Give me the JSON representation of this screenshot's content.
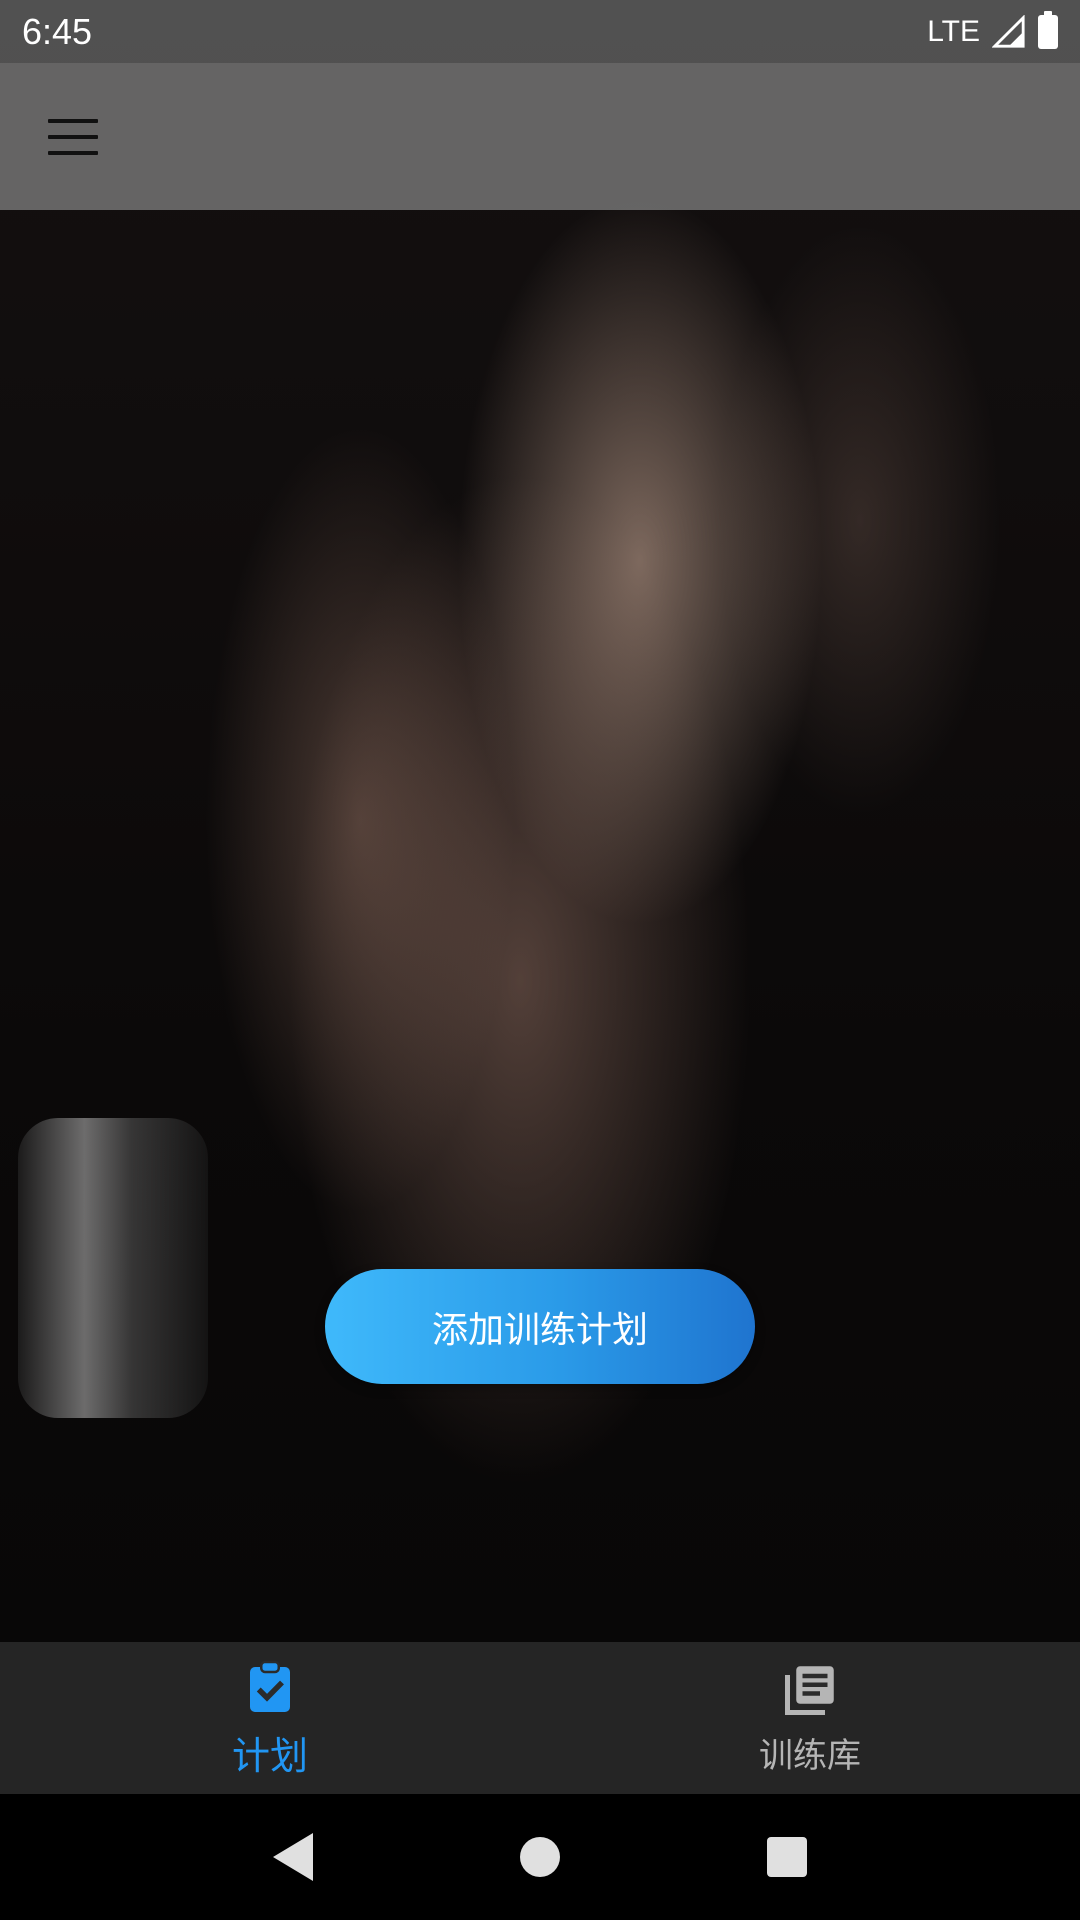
{
  "status_bar": {
    "time": "6:45",
    "network": "LTE"
  },
  "app_bar": {
    "menu_icon": "hamburger-menu-icon"
  },
  "main": {
    "add_plan_button": "添加训练计划"
  },
  "bottom_nav": {
    "items": [
      {
        "label": "计划",
        "icon": "clipboard-check-icon",
        "active": true,
        "color": "#2196f3"
      },
      {
        "label": "训练库",
        "icon": "library-books-icon",
        "active": false,
        "color": "#b5b5b5"
      }
    ]
  },
  "system_nav": {
    "back": "back-icon",
    "home": "home-icon",
    "recents": "recents-icon"
  }
}
